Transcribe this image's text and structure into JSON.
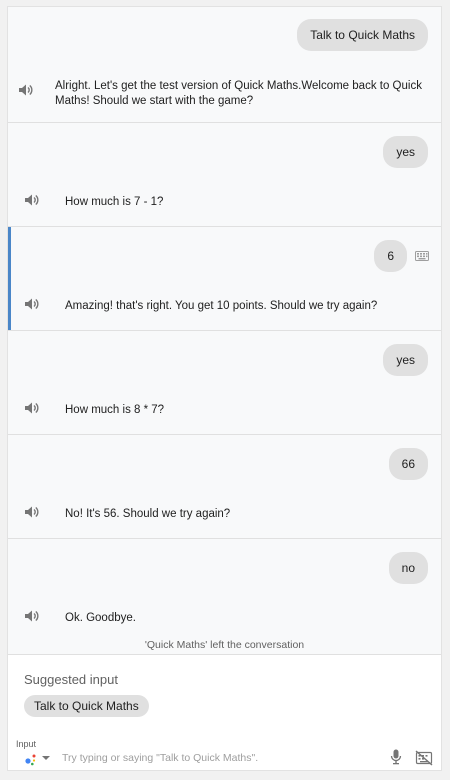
{
  "conversation": {
    "turns": [
      {
        "user": "Talk to Quick Maths",
        "agent": "Alright. Let's get the test version of Quick Maths.Welcome back to Quick Maths! Should we start with the game?"
      },
      {
        "user": "yes",
        "agent": "How much is 7 - 1?"
      },
      {
        "user": "6",
        "agent": "Amazing! that's right. You get 10 points. Should we try again?"
      },
      {
        "user": "yes",
        "agent": "How much is 8 * 7?"
      },
      {
        "user": "66",
        "agent": "No! It's 56. Should we try again?"
      },
      {
        "user": "no",
        "agent": "Ok. Goodbye."
      }
    ],
    "left_message": "'Quick Maths' left the conversation"
  },
  "suggestions": {
    "title": "Suggested input",
    "chips": [
      "Talk to Quick Maths"
    ]
  },
  "input": {
    "label": "Input",
    "placeholder": "Try typing or saying \"Talk to Quick Maths\".",
    "value": ""
  },
  "colors": {
    "accent": "#4a86c8",
    "bubble": "#e0e0e0",
    "panel_bg": "#f8f9fa"
  },
  "icons": {
    "speaker": "speaker-icon",
    "keyboard": "keyboard-icon",
    "assistant": "assistant-icon",
    "mic": "mic-icon",
    "keyboard_off": "keyboard-off-icon"
  }
}
